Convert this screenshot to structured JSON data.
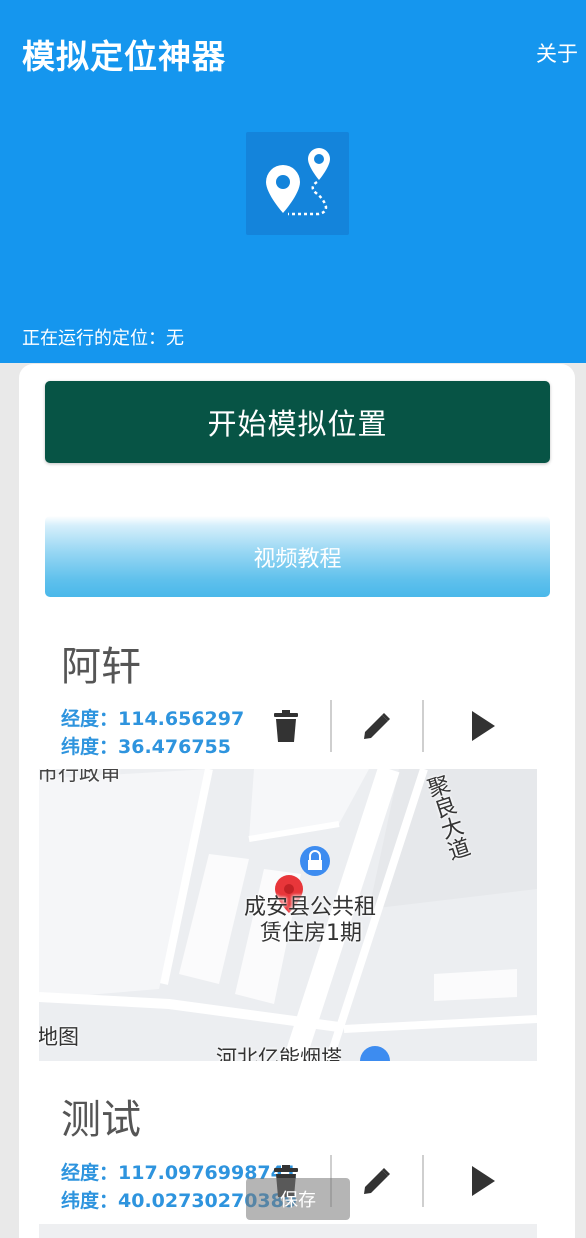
{
  "header": {
    "title": "模拟定位神器",
    "about_label": "关于",
    "status_text": "正在运行的定位：无"
  },
  "buttons": {
    "start_label": "开始模拟位置",
    "video_label": "视频教程"
  },
  "locations": [
    {
      "name": "阿轩",
      "longitude_label": "经度：",
      "longitude": "114.656297",
      "latitude_label": "纬度：",
      "latitude": "36.476755",
      "map": {
        "poi_name_line1": "成安县公共租",
        "poi_name_line2": "赁住房1期",
        "road_label": "聚良大道",
        "provider_label": "地图",
        "bottom_label": "河北亿能烟塔",
        "top_label": "市行政审"
      }
    },
    {
      "name": "测试",
      "longitude_label": "经度：",
      "longitude": "117.0976998741",
      "latitude_label": "纬度：",
      "latitude": "40.02730270389"
    }
  ],
  "toast": "保存",
  "colors": {
    "header_bg": "#1596ee",
    "start_button_bg": "#075445",
    "coord_text": "#2e94de",
    "marker": "#e8363a"
  },
  "icons": [
    "location-route-icon",
    "delete-icon",
    "edit-icon",
    "play-icon",
    "poi-lock-icon",
    "map-marker-icon"
  ]
}
